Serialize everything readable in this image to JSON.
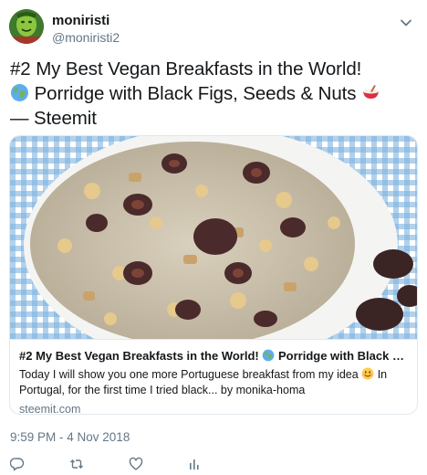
{
  "user": {
    "display_name": "moniristi",
    "handle": "@moniristi2"
  },
  "tweet": {
    "text_line1": "#2 My Best Vegan Breakfasts in the World!",
    "text_line2": "Porridge with Black Figs, Seeds & Nuts",
    "text_line3": "— Steemit",
    "timestamp": "9:59 PM - 4 Nov 2018"
  },
  "card": {
    "title_part1": "#2 My Best Vegan Breakfasts in the World!",
    "title_part2": "Porridge with Black Figs, Se...",
    "desc_part1": "Today I will show you one more Portuguese breakfast from my idea",
    "desc_part2": "In Portugal, for the first time I tried black... by monika-homa",
    "domain": "steemit.com"
  },
  "icons": {
    "more": "chevron-down-icon",
    "reply": "reply-icon",
    "retweet": "retweet-icon",
    "like": "heart-icon",
    "analytics": "analytics-icon"
  },
  "colors": {
    "text": "#14171a",
    "secondary": "#657786",
    "border": "#e1e8ed"
  }
}
